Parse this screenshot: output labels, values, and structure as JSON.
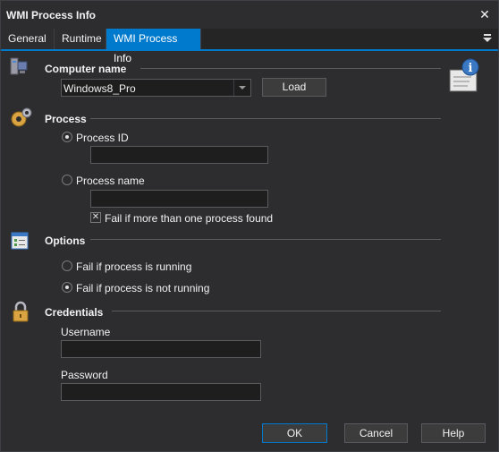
{
  "window": {
    "title": "WMI Process Info"
  },
  "tabs": [
    {
      "label": "General"
    },
    {
      "label": "Runtime"
    },
    {
      "label": "WMI Process Info",
      "active": true
    }
  ],
  "computer": {
    "heading": "Computer name",
    "value": "Windows8_Pro",
    "load_label": "Load"
  },
  "process": {
    "heading": "Process",
    "process_id_label": "Process ID",
    "process_id_value": "",
    "process_name_label": "Process name",
    "process_name_value": "",
    "selected": "process_id",
    "fail_multiple_label": "Fail if more than one process found",
    "fail_multiple_checked": true
  },
  "options": {
    "heading": "Options",
    "fail_running_label": "Fail if process is running",
    "fail_not_running_label": "Fail if process is not running",
    "selected": "fail_not_running"
  },
  "credentials": {
    "heading": "Credentials",
    "username_label": "Username",
    "username_value": "",
    "password_label": "Password",
    "password_value": ""
  },
  "buttons": {
    "ok": "OK",
    "cancel": "Cancel",
    "help": "Help"
  },
  "colors": {
    "accent": "#007acc",
    "background": "#2d2d30",
    "field": "#1e1e1e"
  }
}
